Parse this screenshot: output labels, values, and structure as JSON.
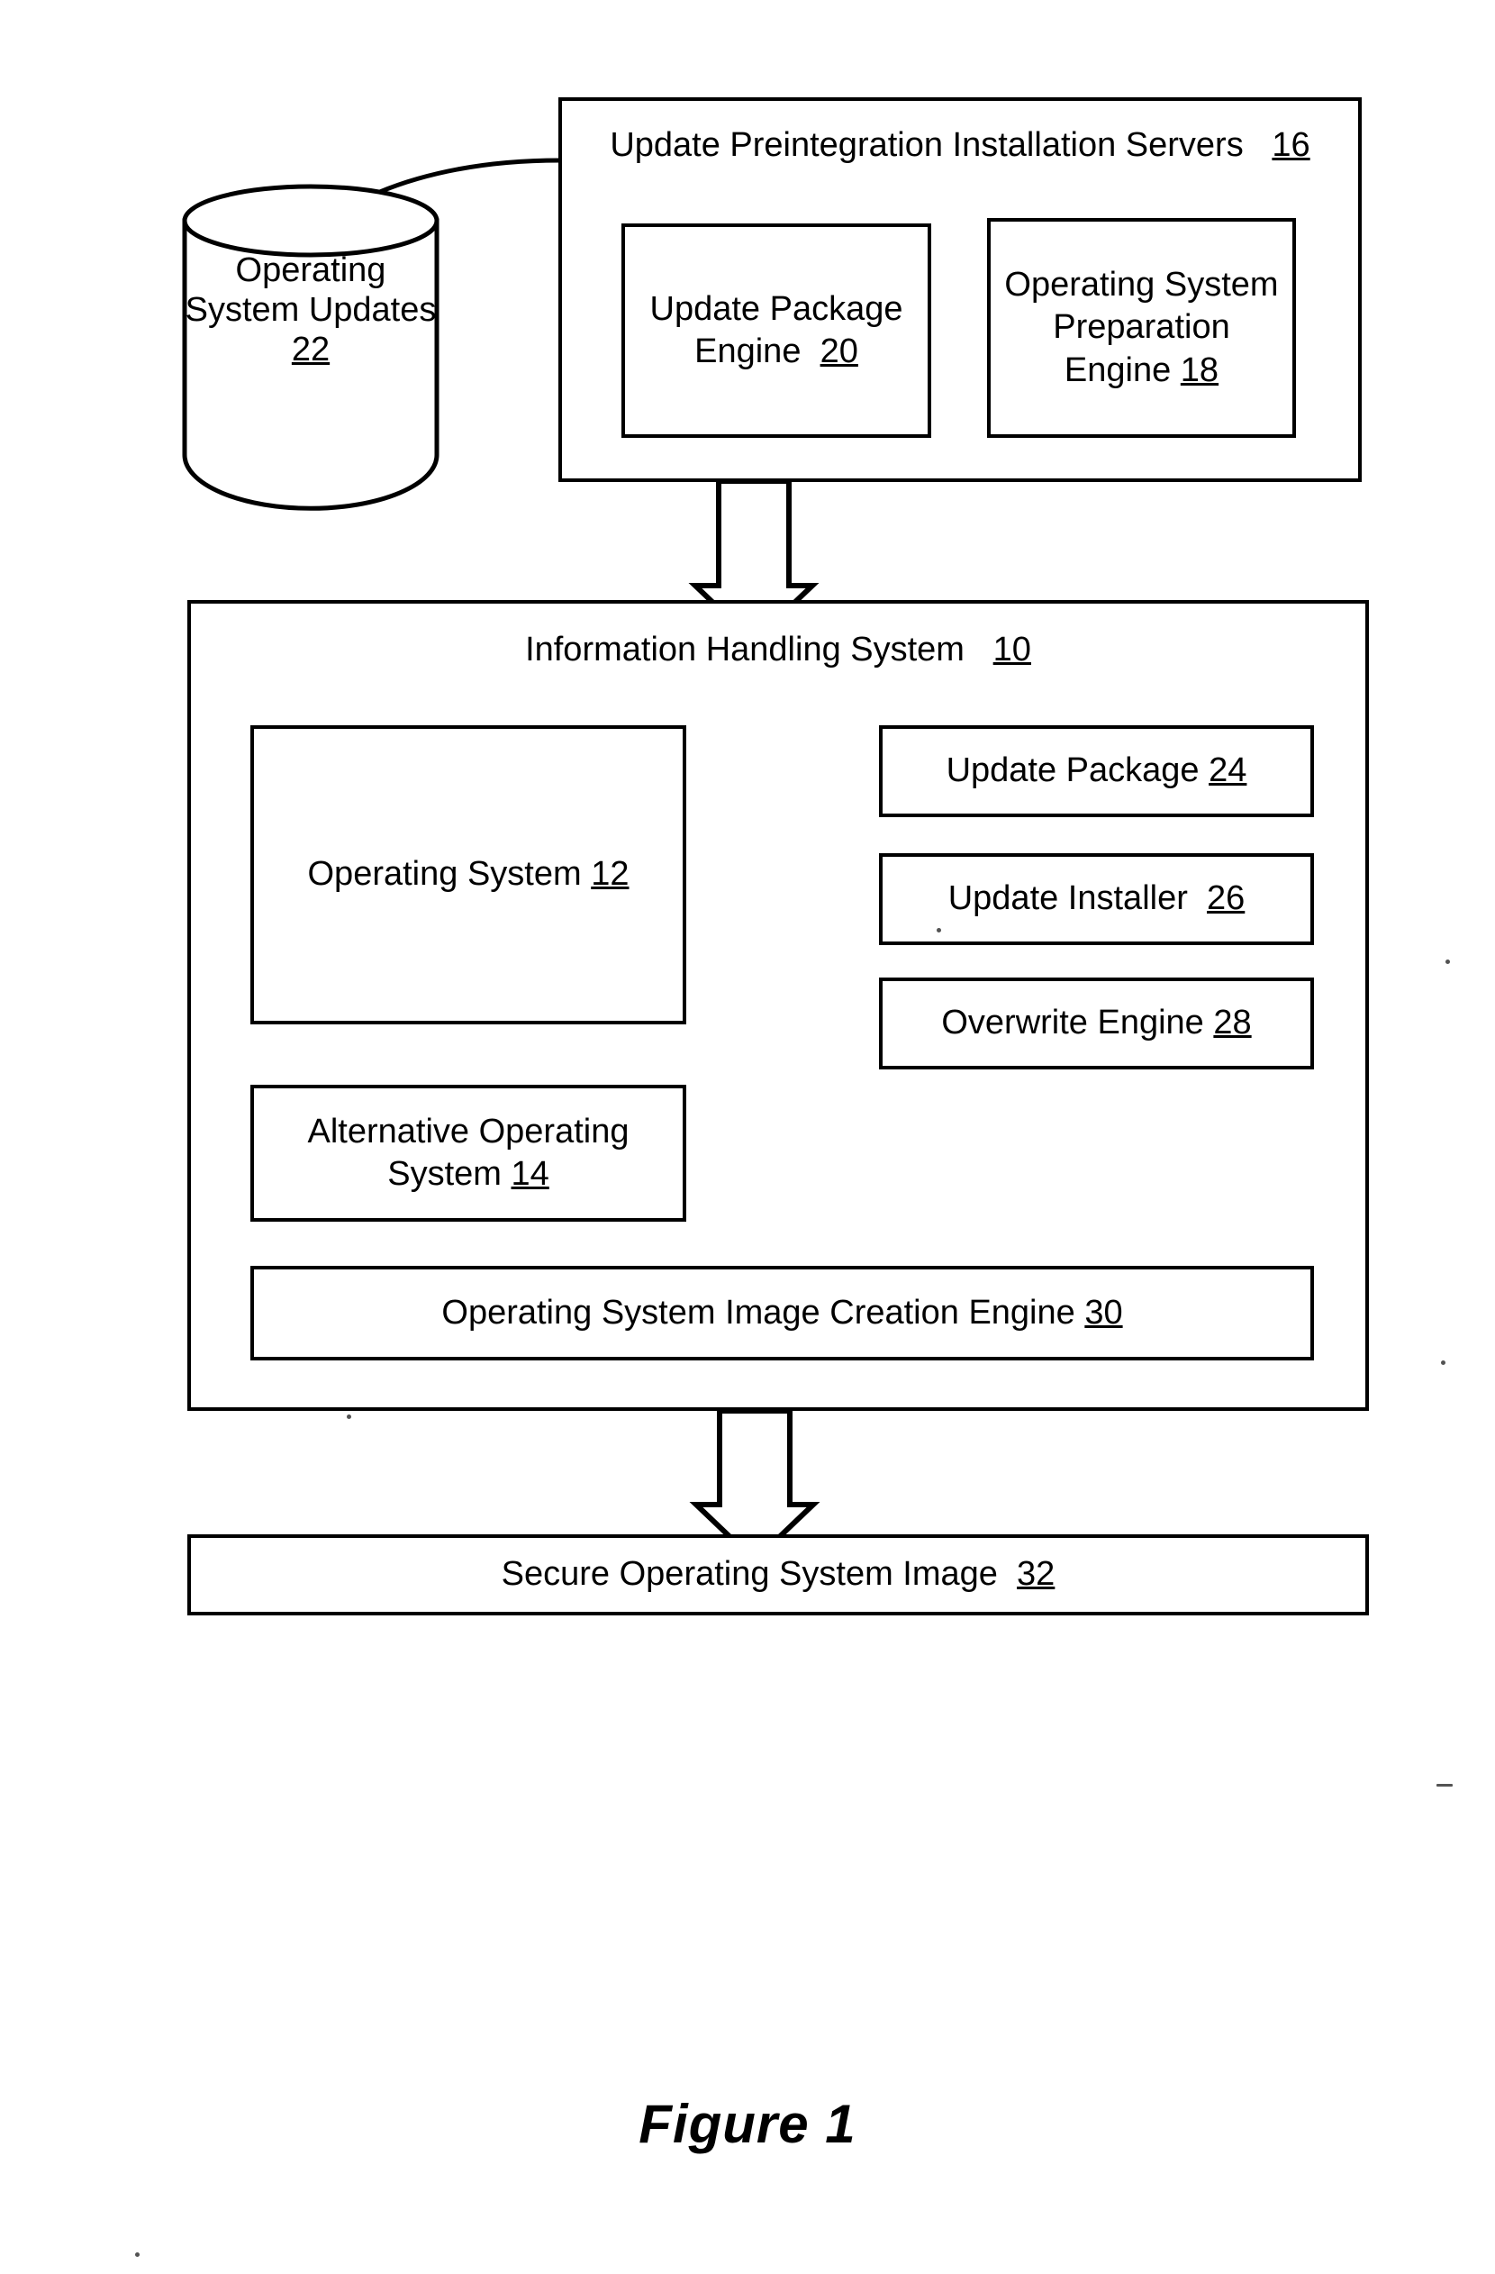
{
  "figure": {
    "caption": "Figure 1"
  },
  "datastore": {
    "name": "os-updates-cylinder",
    "label": "Operating\nSystem\nUpdates",
    "ref": "22"
  },
  "servers": {
    "title": "Update Preintegration Installation Servers",
    "ref": "16",
    "children": [
      {
        "name": "update-package-engine",
        "label": "Update Package\nEngine",
        "ref": "20"
      },
      {
        "name": "operating-system-preparation-engine",
        "label": "Operating System\nPreparation\nEngine",
        "ref": "18"
      }
    ]
  },
  "information_handling_system": {
    "title": "Information Handling System",
    "ref": "10",
    "operating_system": {
      "label": "Operating System",
      "ref": "12"
    },
    "alternative_operating_system": {
      "label": "Alternative Operating\nSystem",
      "ref": "14"
    },
    "image_creation_engine": {
      "label": "Operating System Image Creation Engine",
      "ref": "30"
    },
    "inputs": [
      {
        "name": "update-package",
        "label": "Update Package",
        "ref": "24"
      },
      {
        "name": "update-installer",
        "label": "Update Installer",
        "ref": "26"
      },
      {
        "name": "overwrite-engine",
        "label": "Overwrite Engine",
        "ref": "28"
      }
    ]
  },
  "output": {
    "label": "Secure Operating System Image",
    "ref": "32"
  },
  "colors": {
    "stroke": "#000000",
    "fill": "#ffffff",
    "text": "#000000"
  }
}
